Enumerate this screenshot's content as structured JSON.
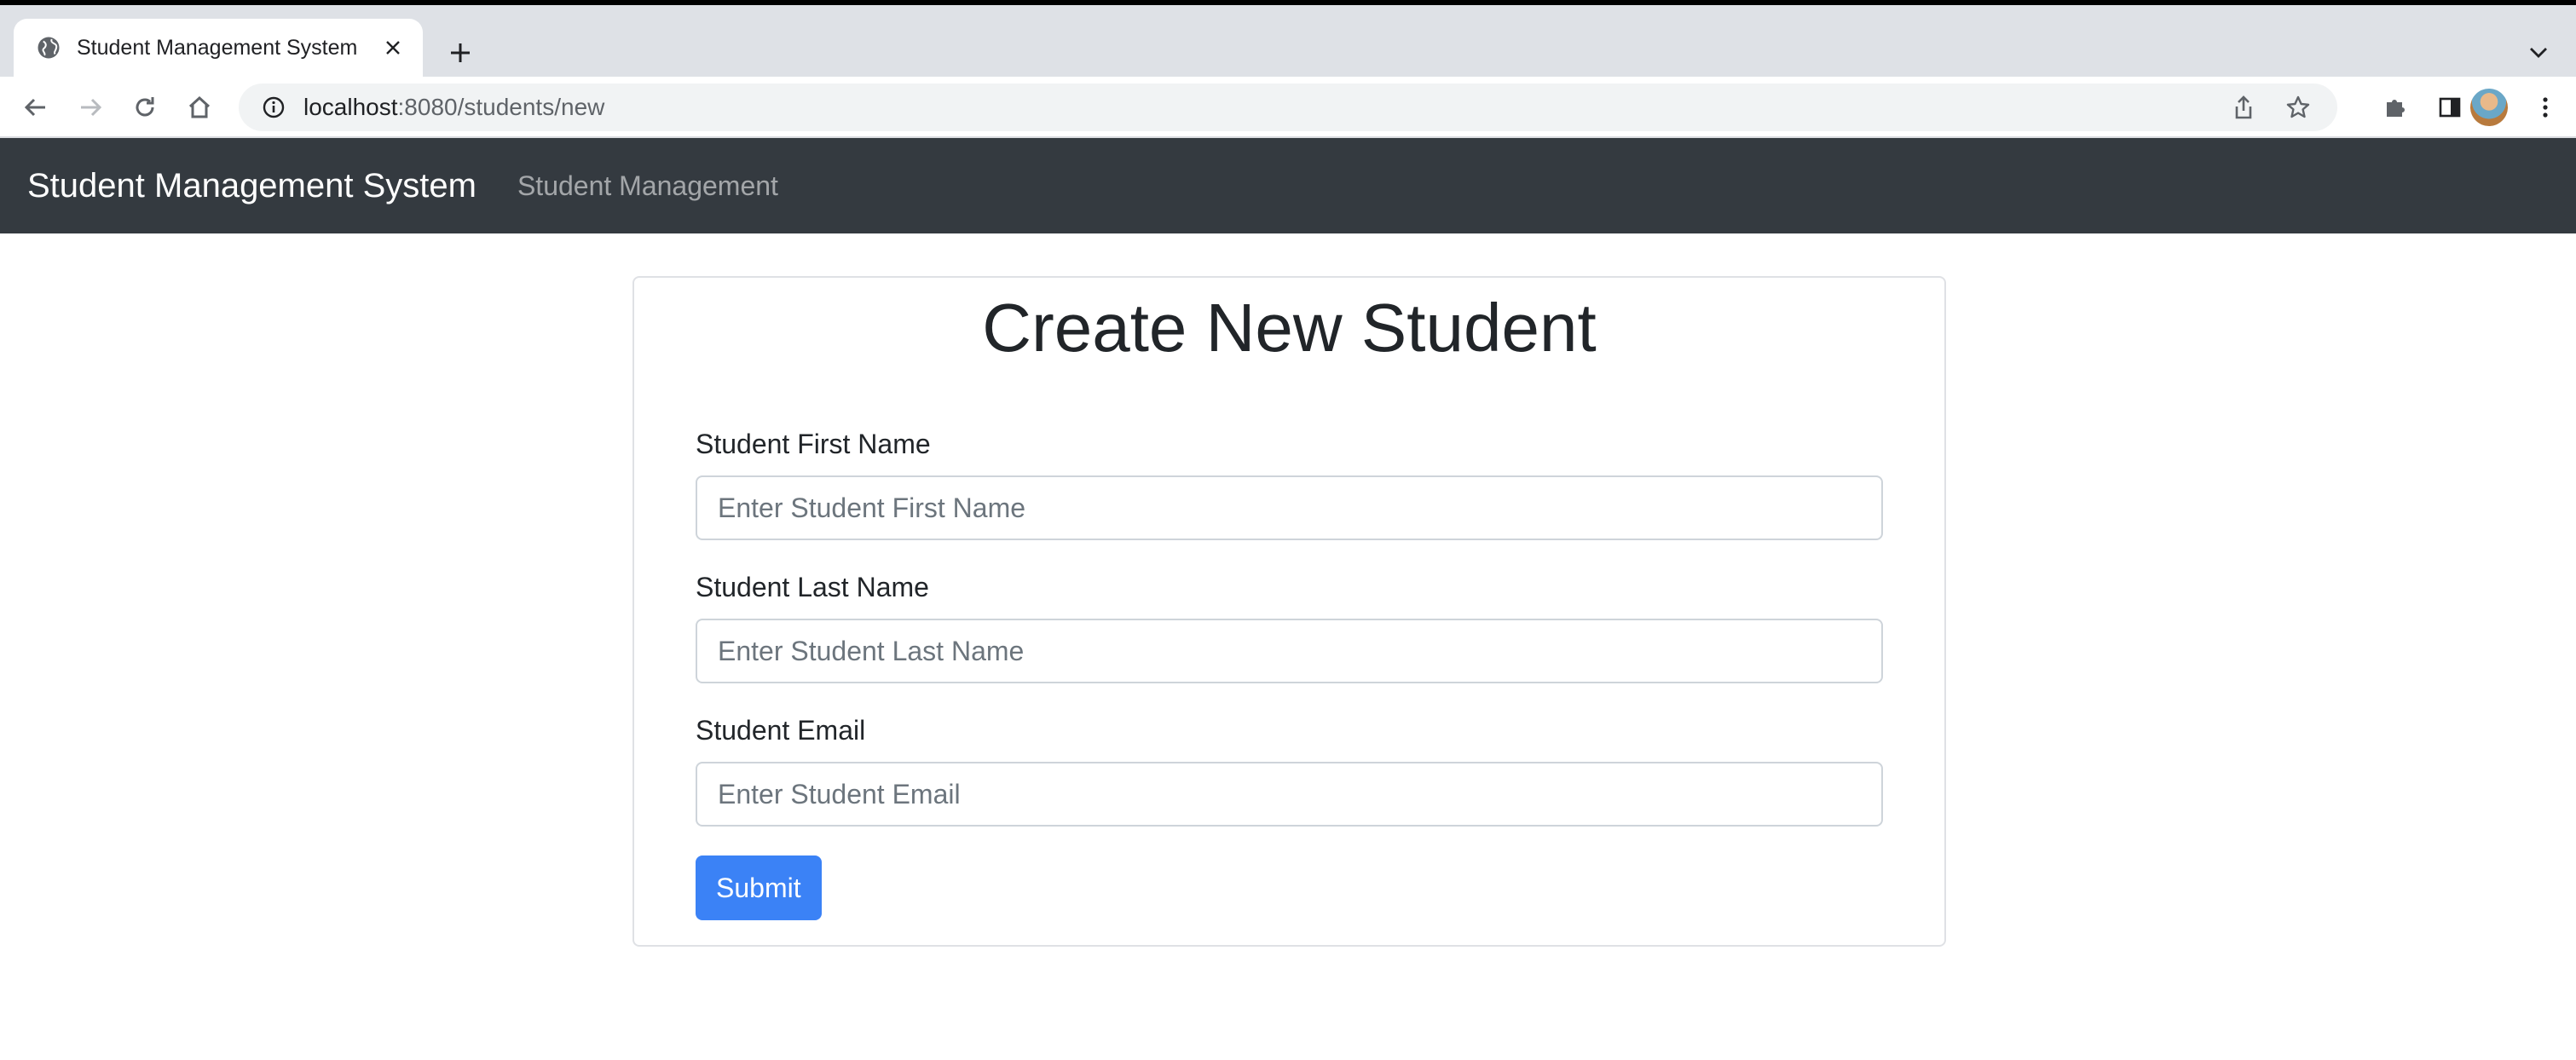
{
  "browser": {
    "tab_title": "Student Management System",
    "url_host": "localhost",
    "url_path": ":8080/students/new"
  },
  "navbar": {
    "brand": "Student Management System",
    "link": "Student Management"
  },
  "form": {
    "title": "Create New Student",
    "first_name_label": "Student First Name",
    "first_name_placeholder": "Enter Student First Name",
    "last_name_label": "Student Last Name",
    "last_name_placeholder": "Enter Student Last Name",
    "email_label": "Student Email",
    "email_placeholder": "Enter Student Email",
    "submit_label": "Submit"
  },
  "colors": {
    "navbar": "#343a40",
    "primary_button": "#3b82f6"
  }
}
